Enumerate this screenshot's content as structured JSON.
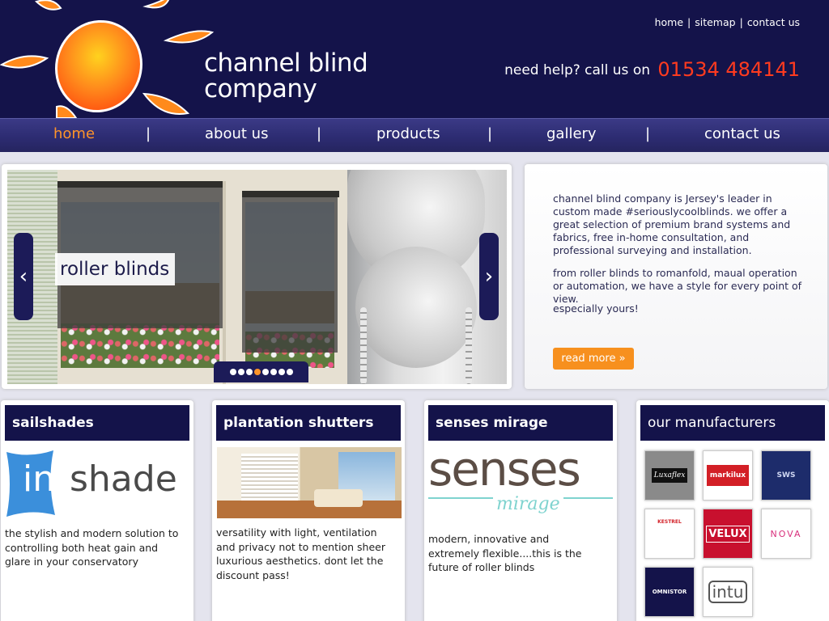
{
  "header": {
    "brand_line1": "channel blind",
    "brand_line2": "company",
    "top_links": [
      "home",
      "sitemap",
      "contact us"
    ],
    "help_text": "need help? call us on",
    "phone": "01534 484141"
  },
  "nav": {
    "items": [
      "home",
      "about us",
      "products",
      "gallery",
      "contact us"
    ],
    "active": "home"
  },
  "slider": {
    "caption": "roller blinds",
    "prev_symbol": "‹",
    "next_symbol": "›",
    "dot_count": 8,
    "active_dot": 4
  },
  "intro": {
    "p1": "channel blind company is Jersey's leader in custom made #seriouslycoolblinds. we offer a great selection of premium brand systems and fabrics, free in-home consultation, and professional surveying and installation.",
    "p2": "from roller blinds to romanfold, maual operation or automation, we have a style for every point of view.",
    "p3": "especially yours!",
    "read_more": "read more  »"
  },
  "cards": {
    "sailshades": {
      "title": "sailshades",
      "logo_text_in": "in",
      "logo_text_shade": "shade",
      "text": "the stylish and modern solution to controlling both heat gain and glare in your conservatory"
    },
    "shutters": {
      "title": "plantation shutters",
      "text": "versatility with light, ventilation and privacy not to mention sheer luxurious aesthetics. dont let the discount pass!"
    },
    "senses": {
      "title": "senses mirage",
      "logo_text": "senses",
      "logo_sub": "mirage",
      "text": "modern, innovative and extremely flexible....this is the future of roller blinds"
    },
    "manufacturers": {
      "title": "our manufacturers",
      "logos": [
        "Luxaflex",
        "markilux",
        "SWS",
        "KESTREL",
        "VELUX",
        "NOVA",
        "OMNISTOR",
        "intu"
      ]
    }
  },
  "colors": {
    "navy": "#14134a",
    "accent_orange": "#f7901e",
    "phone_red": "#ff3b1f"
  }
}
